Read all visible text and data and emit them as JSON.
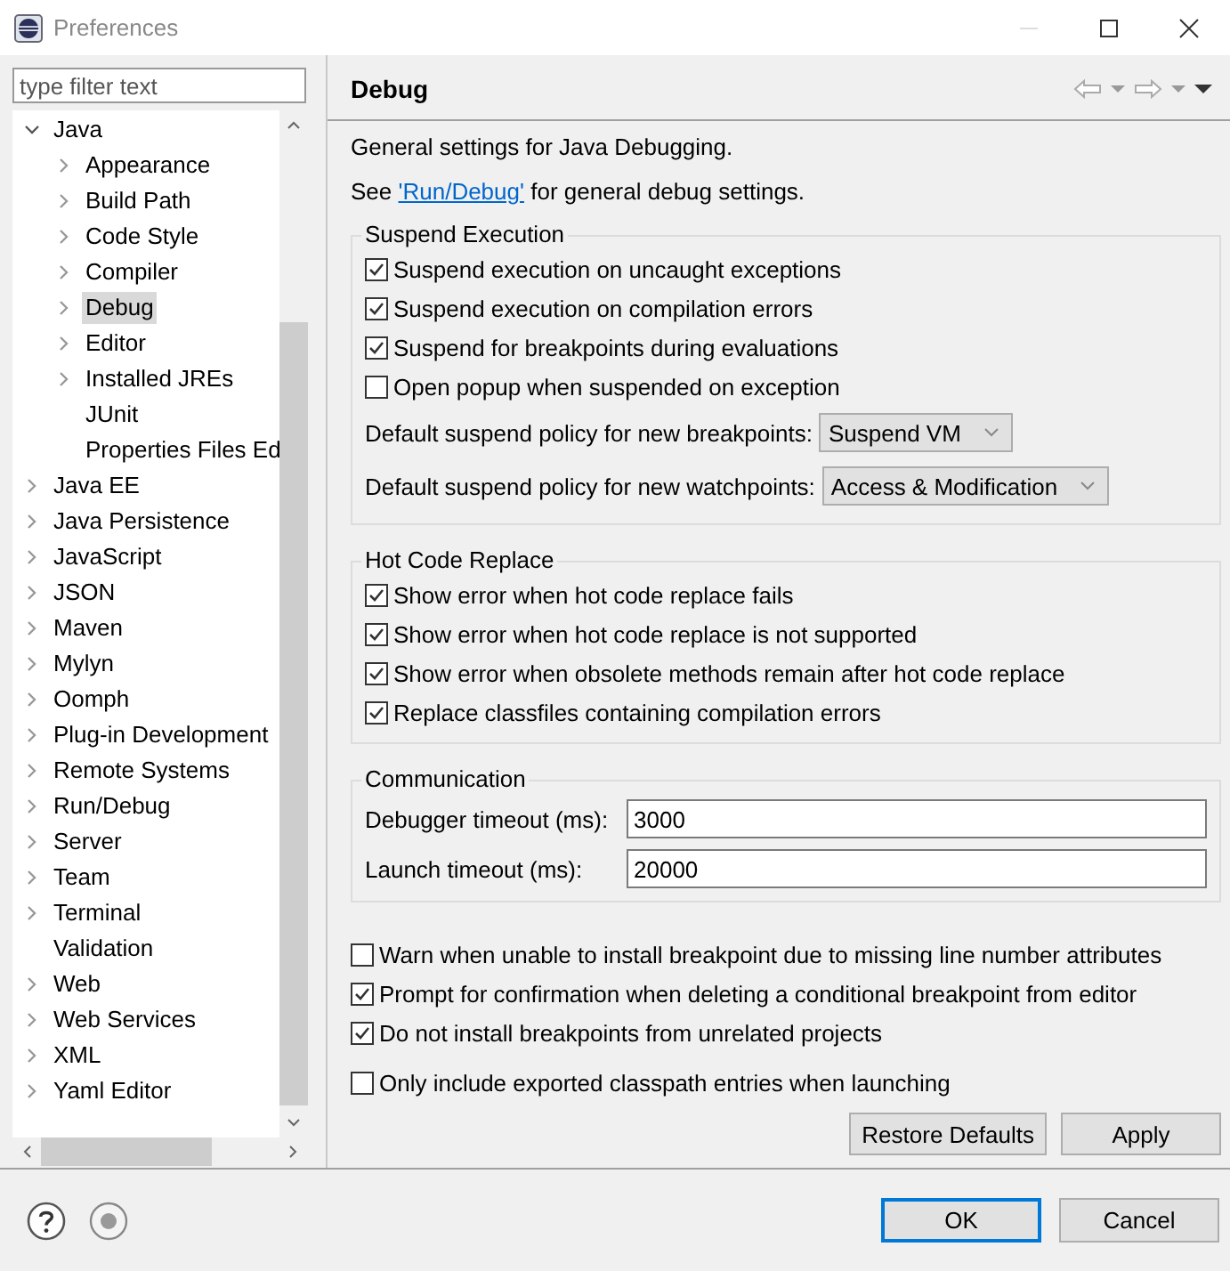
{
  "window": {
    "title": "Preferences"
  },
  "filter": {
    "placeholder": "type filter text"
  },
  "tree": [
    {
      "label": "Java",
      "expanded": true,
      "selected": false,
      "children": [
        {
          "label": "Appearance",
          "expanded": false,
          "selected": false
        },
        {
          "label": "Build Path",
          "expanded": false,
          "selected": false
        },
        {
          "label": "Code Style",
          "expanded": false,
          "selected": false
        },
        {
          "label": "Compiler",
          "expanded": false,
          "selected": false
        },
        {
          "label": "Debug",
          "expanded": false,
          "selected": true
        },
        {
          "label": "Editor",
          "expanded": false,
          "selected": false
        },
        {
          "label": "Installed JREs",
          "expanded": false,
          "selected": false
        },
        {
          "label": "JUnit",
          "selected": false
        },
        {
          "label": "Properties Files Ed",
          "selected": false
        }
      ]
    },
    {
      "label": "Java EE",
      "expanded": false,
      "selected": false
    },
    {
      "label": "Java Persistence",
      "expanded": false,
      "selected": false
    },
    {
      "label": "JavaScript",
      "expanded": false,
      "selected": false
    },
    {
      "label": "JSON",
      "expanded": false,
      "selected": false
    },
    {
      "label": "Maven",
      "expanded": false,
      "selected": false
    },
    {
      "label": "Mylyn",
      "expanded": false,
      "selected": false
    },
    {
      "label": "Oomph",
      "expanded": false,
      "selected": false
    },
    {
      "label": "Plug-in Development",
      "expanded": false,
      "selected": false
    },
    {
      "label": "Remote Systems",
      "expanded": false,
      "selected": false
    },
    {
      "label": "Run/Debug",
      "expanded": false,
      "selected": false
    },
    {
      "label": "Server",
      "expanded": false,
      "selected": false
    },
    {
      "label": "Team",
      "expanded": false,
      "selected": false
    },
    {
      "label": "Terminal",
      "expanded": false,
      "selected": false
    },
    {
      "label": "Validation",
      "selected": false
    },
    {
      "label": "Web",
      "expanded": false,
      "selected": false
    },
    {
      "label": "Web Services",
      "expanded": false,
      "selected": false
    },
    {
      "label": "XML",
      "expanded": false,
      "selected": false
    },
    {
      "label": "Yaml Editor",
      "expanded": false,
      "selected": false
    }
  ],
  "page": {
    "title": "Debug",
    "description": "General settings for Java Debugging.",
    "see_also": {
      "before": "See ",
      "link": "'Run/Debug'",
      "after": " for general debug settings."
    },
    "suspend_execution": {
      "title": "Suspend Execution",
      "checkboxes": [
        {
          "label": "Suspend execution on uncaught exceptions",
          "checked": true
        },
        {
          "label": "Suspend execution on compilation errors",
          "checked": true
        },
        {
          "label": "Suspend for breakpoints during evaluations",
          "checked": true
        },
        {
          "label": "Open popup when suspended on exception",
          "checked": false
        }
      ],
      "policies": [
        {
          "label": "Default suspend policy for new breakpoints:",
          "value": "Suspend VM"
        },
        {
          "label": "Default suspend policy for new watchpoints:",
          "value": "Access & Modification"
        }
      ]
    },
    "hot_code_replace": {
      "title": "Hot Code Replace",
      "checkboxes": [
        {
          "label": "Show error when hot code replace fails",
          "checked": true
        },
        {
          "label": "Show error when hot code replace is not supported",
          "checked": true
        },
        {
          "label": "Show error when obsolete methods remain after hot code replace",
          "checked": true
        },
        {
          "label": "Replace classfiles containing compilation errors",
          "checked": true
        }
      ]
    },
    "communication": {
      "title": "Communication",
      "fields": [
        {
          "label": "Debugger timeout (ms):",
          "value": "3000"
        },
        {
          "label": "Launch timeout (ms):",
          "value": "20000"
        }
      ]
    },
    "options": [
      {
        "label": "Warn when unable to install breakpoint due to missing line number attributes",
        "checked": false
      },
      {
        "label": "Prompt for confirmation when deleting a conditional breakpoint from editor",
        "checked": true
      },
      {
        "label": "Do not install breakpoints from unrelated projects",
        "checked": true
      },
      {
        "label": "Only include exported classpath entries when launching",
        "checked": false
      }
    ],
    "buttons": [
      "Restore Defaults",
      "Apply"
    ]
  },
  "dialog_buttons": [
    {
      "label": "OK",
      "default": true
    },
    {
      "label": "Cancel",
      "default": false
    }
  ]
}
